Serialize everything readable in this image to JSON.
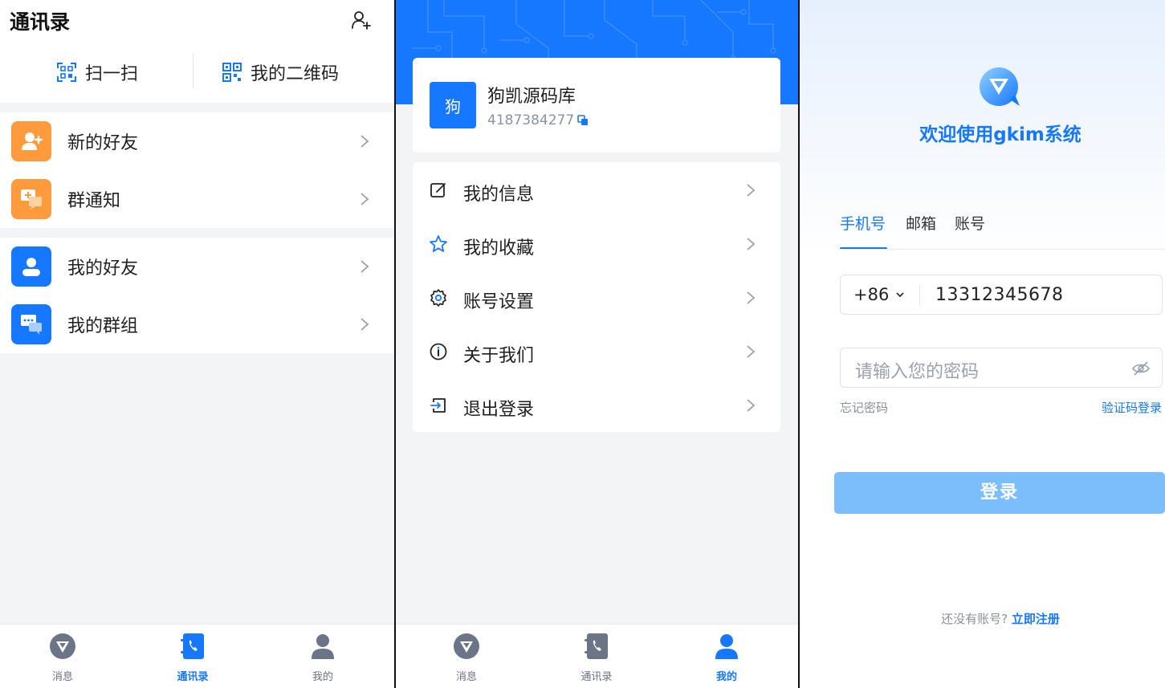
{
  "contacts": {
    "title": "通讯录",
    "scan_label": "扫一扫",
    "qrcode_label": "我的二维码",
    "new_friends": "新的好友",
    "group_notice": "群通知",
    "my_friends": "我的好友",
    "my_groups": "我的群组"
  },
  "profile": {
    "avatar_text": "狗",
    "name": "狗凯源码库",
    "id": "4187384277",
    "menu": [
      "我的信息",
      "我的收藏",
      "账号设置",
      "关于我们",
      "退出登录"
    ]
  },
  "tabbar": {
    "messages": "消息",
    "contacts": "通讯录",
    "me": "我的"
  },
  "login": {
    "welcome": "欢迎使用gkim系统",
    "tabs": [
      "手机号",
      "邮箱",
      "账号"
    ],
    "country_code": "+86",
    "phone_value": "13312345678",
    "password_placeholder": "请输入您的密码",
    "forgot": "忘记密码",
    "code_login": "验证码登录",
    "button": "登录",
    "no_account": "还没有账号?",
    "register": "立即注册"
  },
  "colors": {
    "accent": "#1677ff",
    "orange": "#ff9b3d",
    "disabled_button": "#7cbdfb"
  }
}
